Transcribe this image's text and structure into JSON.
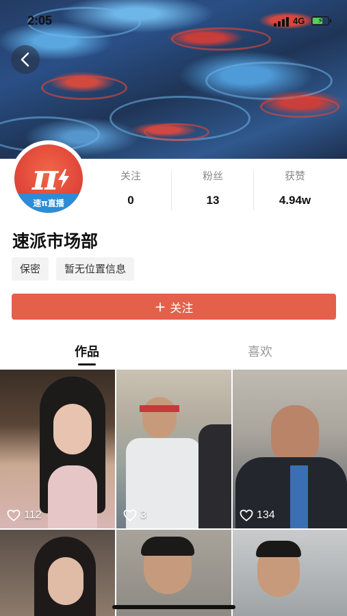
{
  "status_bar": {
    "time": "2:05",
    "network": "4G"
  },
  "profile": {
    "avatar_brand": "速π直播",
    "name": "速派市场部",
    "tags": [
      "保密",
      "暂无位置信息"
    ],
    "follow_label": "关注"
  },
  "stats": [
    {
      "label": "关注",
      "value": "0"
    },
    {
      "label": "粉丝",
      "value": "13"
    },
    {
      "label": "获赞",
      "value": "4.94w"
    }
  ],
  "tabs": [
    {
      "label": "作品",
      "active": true
    },
    {
      "label": "喜欢",
      "active": false
    }
  ],
  "videos": [
    {
      "likes": "112"
    },
    {
      "likes": "3"
    },
    {
      "likes": "134"
    },
    {
      "likes": ""
    },
    {
      "likes": ""
    },
    {
      "likes": ""
    }
  ],
  "colors": {
    "accent": "#e4604b",
    "avatar_red": "#e2493b",
    "avatar_blue": "#2c8dd6"
  },
  "icons": [
    "back-icon",
    "signal-icon",
    "battery-icon",
    "plus-icon",
    "heart-icon"
  ]
}
